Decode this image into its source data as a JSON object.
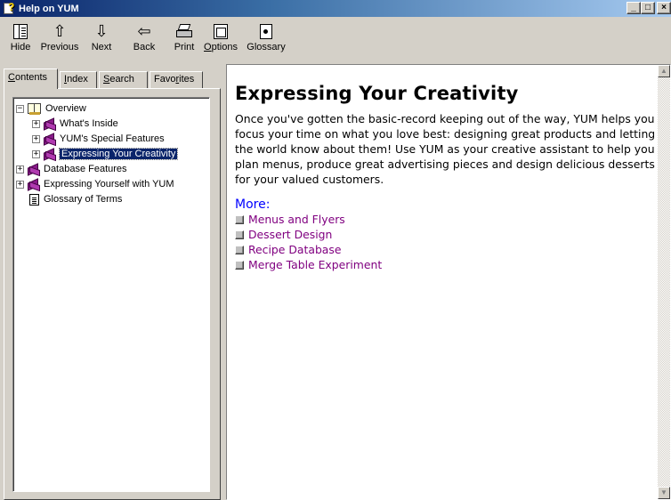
{
  "window": {
    "title": "Help on YUM"
  },
  "toolbar": {
    "hide": "Hide",
    "previous": "Previous",
    "next": "Next",
    "back": "Back",
    "print": "Print",
    "options_underlined": "O",
    "options_rest": "ptions",
    "glossary": "Glossary"
  },
  "tabs": {
    "contents_u": "C",
    "contents_rest": "ontents",
    "index_u": "I",
    "index_rest": "ndex",
    "search_u": "S",
    "search_rest": "earch",
    "fav_pre": "Favo",
    "fav_u": "r",
    "fav_rest": "ites"
  },
  "tree": [
    {
      "label": "Overview"
    },
    {
      "label": "What's Inside"
    },
    {
      "label": "YUM's Special Features"
    },
    {
      "label": "Expressing Your Creativity",
      "selected": true
    },
    {
      "label": "Database Features"
    },
    {
      "label": "Expressing Yourself with YUM"
    },
    {
      "label": "Glossary of Terms"
    }
  ],
  "content": {
    "title": "Expressing Your Creativity",
    "body": "Once you've gotten the basic-record keeping out of the way, YUM helps you focus your time on what you love best: designing great products and letting the world know about them! Use YUM as your creative assistant to help you plan menus, produce great advertising pieces and design delicious desserts for your valued customers.",
    "more_label": "More:",
    "links": [
      "Menus and Flyers",
      "Dessert Design",
      "Recipe Database",
      "Merge Table Experiment"
    ]
  },
  "icons": {
    "expand": "plus-box-icon",
    "collapse": "minus-box-icon",
    "closed_book": "closed-book-icon",
    "open_book": "open-book-icon",
    "page": "page-icon"
  },
  "colors": {
    "title_bar": "#0a246a",
    "selection": "#0a246a",
    "link": "#800080",
    "more": "#0000ff"
  }
}
